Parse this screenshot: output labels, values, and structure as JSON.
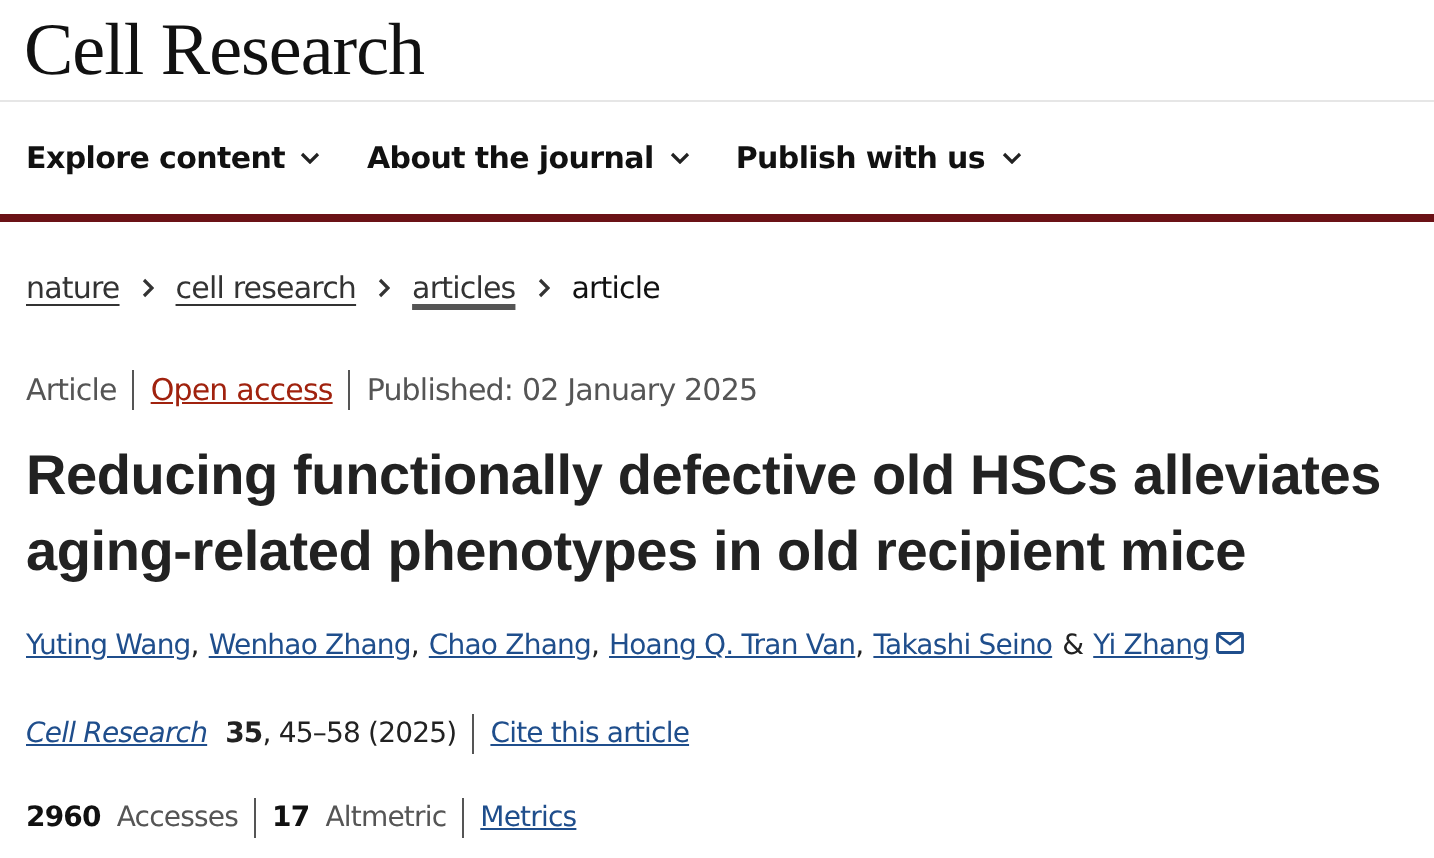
{
  "journal_title": "Cell Research",
  "nav": [
    {
      "label": "Explore content"
    },
    {
      "label": "About the journal"
    },
    {
      "label": "Publish with us"
    }
  ],
  "breadcrumb": [
    {
      "label": "nature",
      "current": false
    },
    {
      "label": "cell research",
      "current": false
    },
    {
      "label": "articles",
      "current": false
    },
    {
      "label": "article",
      "current": true
    }
  ],
  "meta": {
    "type": "Article",
    "access": "Open access",
    "published": "Published: 02 January 2025"
  },
  "title": "Reducing functionally defective old HSCs alleviates aging-related phenotypes in old recipient mice",
  "authors": [
    {
      "name": "Yuting Wang",
      "sep": ",",
      "corresponding": false
    },
    {
      "name": "Wenhao Zhang",
      "sep": ",",
      "corresponding": false
    },
    {
      "name": "Chao Zhang",
      "sep": ",",
      "corresponding": false
    },
    {
      "name": "Hoang Q. Tran Van",
      "sep": ",",
      "corresponding": false
    },
    {
      "name": "Takashi Seino",
      "sep": "&",
      "corresponding": false
    },
    {
      "name": "Yi Zhang",
      "corresponding": true
    }
  ],
  "citation": {
    "journal": "Cell Research",
    "volume": "35",
    "pages": ", 45–58 (2025)",
    "cite_link": "Cite this article"
  },
  "metrics": {
    "accesses_count": "2960",
    "accesses_label": "Accesses",
    "altmetric_count": "17",
    "altmetric_label": "Altmetric",
    "link": "Metrics"
  }
}
